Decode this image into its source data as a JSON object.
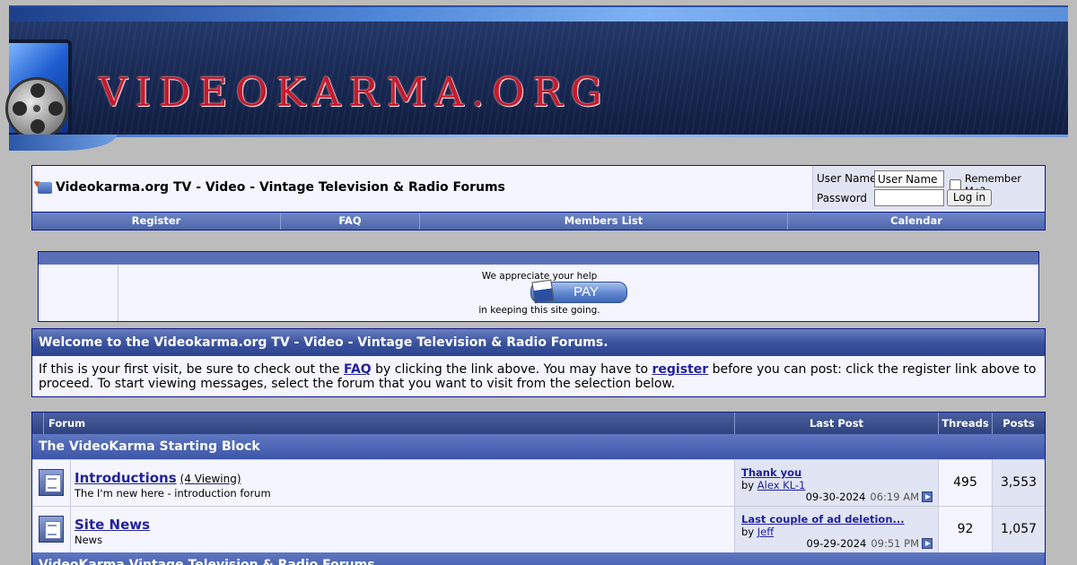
{
  "banner": {
    "logo_text": "VIDEOKARMA.ORG"
  },
  "navbar": {
    "site_title": "Videokarma.org TV - Video - Vintage Television & Radio Forums",
    "login": {
      "username_label": "User Name",
      "username_value": "User Name",
      "password_label": "Password",
      "remember_label": "Remember Me?",
      "remember_checked": false,
      "login_button": "Log in"
    },
    "links": [
      {
        "label": "Register"
      },
      {
        "label": "FAQ"
      },
      {
        "label": "Members List"
      },
      {
        "label": "Calendar"
      }
    ]
  },
  "donate": {
    "line1": "We appreciate your help",
    "button": "PAY",
    "line2": "in keeping this site going."
  },
  "welcome": {
    "title": "Welcome to the Videokarma.org TV - Video - Vintage Television & Radio Forums.",
    "text_1": "If this is your first visit, be sure to check out the ",
    "faq_link": "FAQ",
    "text_2": " by clicking the link above. You may have to ",
    "register_link": "register",
    "text_3": " before you can post: click the register link above to proceed. To start viewing messages, select the forum that you want to visit from the selection below."
  },
  "forum_table": {
    "headers": {
      "forum": "Forum",
      "last_post": "Last Post",
      "threads": "Threads",
      "posts": "Posts"
    },
    "categories": [
      {
        "title": "The VideoKarma Starting Block"
      },
      {
        "title": "VideoKarma Vintage Television & Radio Forums"
      }
    ],
    "forums": [
      {
        "name": "Introductions",
        "viewing": "(4 Viewing)",
        "description": "The I'm new here - introduction forum",
        "last_post_title": "Thank you",
        "by_label": "by",
        "last_post_user": "Alex KL-1",
        "last_post_date": "09-30-2024",
        "last_post_time": "06:19 AM",
        "threads": "495",
        "posts": "3,553"
      },
      {
        "name": "Site News",
        "viewing": "",
        "description": "News",
        "last_post_title": "Last couple of ad deletion...",
        "by_label": "by",
        "last_post_user": "Jeff",
        "last_post_date": "09-29-2024",
        "last_post_time": "09:51 PM",
        "threads": "92",
        "posts": "1,057"
      }
    ]
  }
}
